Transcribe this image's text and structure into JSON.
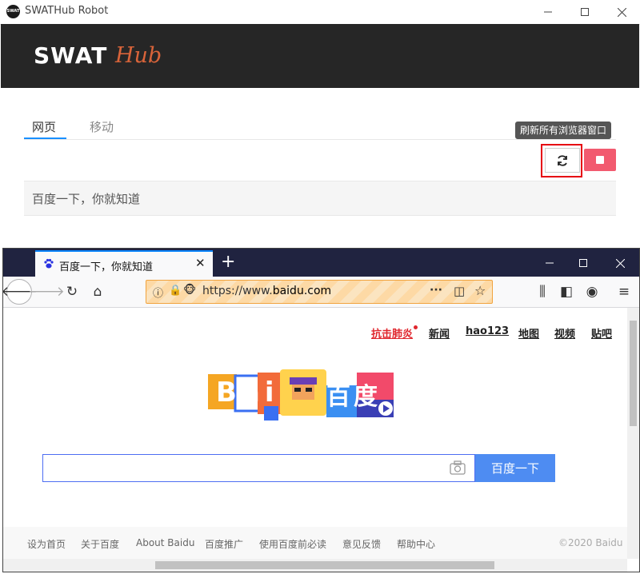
{
  "app": {
    "title": "SWATHub Robot",
    "logo_text": "SWAT",
    "logo_hub": "Hub",
    "logo_small": "SWAT",
    "tabs": [
      {
        "label": "网页",
        "active": true
      },
      {
        "label": "移动",
        "active": false
      }
    ],
    "tooltip": "刷新所有浏览器窗口",
    "page_list": [
      {
        "title": "百度一下，你就知道"
      }
    ]
  },
  "browser": {
    "tab_title": "百度一下，你就知道",
    "url_prefix": "https://www.",
    "url_domain": "baidu.com",
    "top_links": [
      "抗击肺炎",
      "新闻",
      "hao123",
      "地图",
      "视频",
      "贴吧"
    ],
    "logo_text": "Bai",
    "logo_du": "百度",
    "search_value": "",
    "search_button": "百度一下",
    "footer_links": [
      "设为首页",
      "关于百度",
      "About Baidu",
      "百度推广",
      "使用百度前必读",
      "意见反馈",
      "帮助中心"
    ],
    "copyright": "©2020 Baidu"
  },
  "colors": {
    "header_bg": "#262626",
    "hub_accent": "#d9643a",
    "tab_active": "#1890ff",
    "stop_button": "#f25a6f",
    "highlight_frame": "#e60012",
    "ff_tabbar": "#202340",
    "baidu_blue": "#4e8cf2",
    "hot_red": "#e0272e"
  },
  "icons": [
    "refresh-icon",
    "stop-icon",
    "minimize-icon",
    "maximize-icon",
    "close-icon",
    "paw-icon",
    "back-icon",
    "forward-icon",
    "reload-icon",
    "home-icon",
    "info-icon",
    "lock-icon",
    "more-icon",
    "pocket-icon",
    "star-icon",
    "library-icon",
    "sidebar-icon",
    "account-icon",
    "menu-icon",
    "camera-icon"
  ]
}
